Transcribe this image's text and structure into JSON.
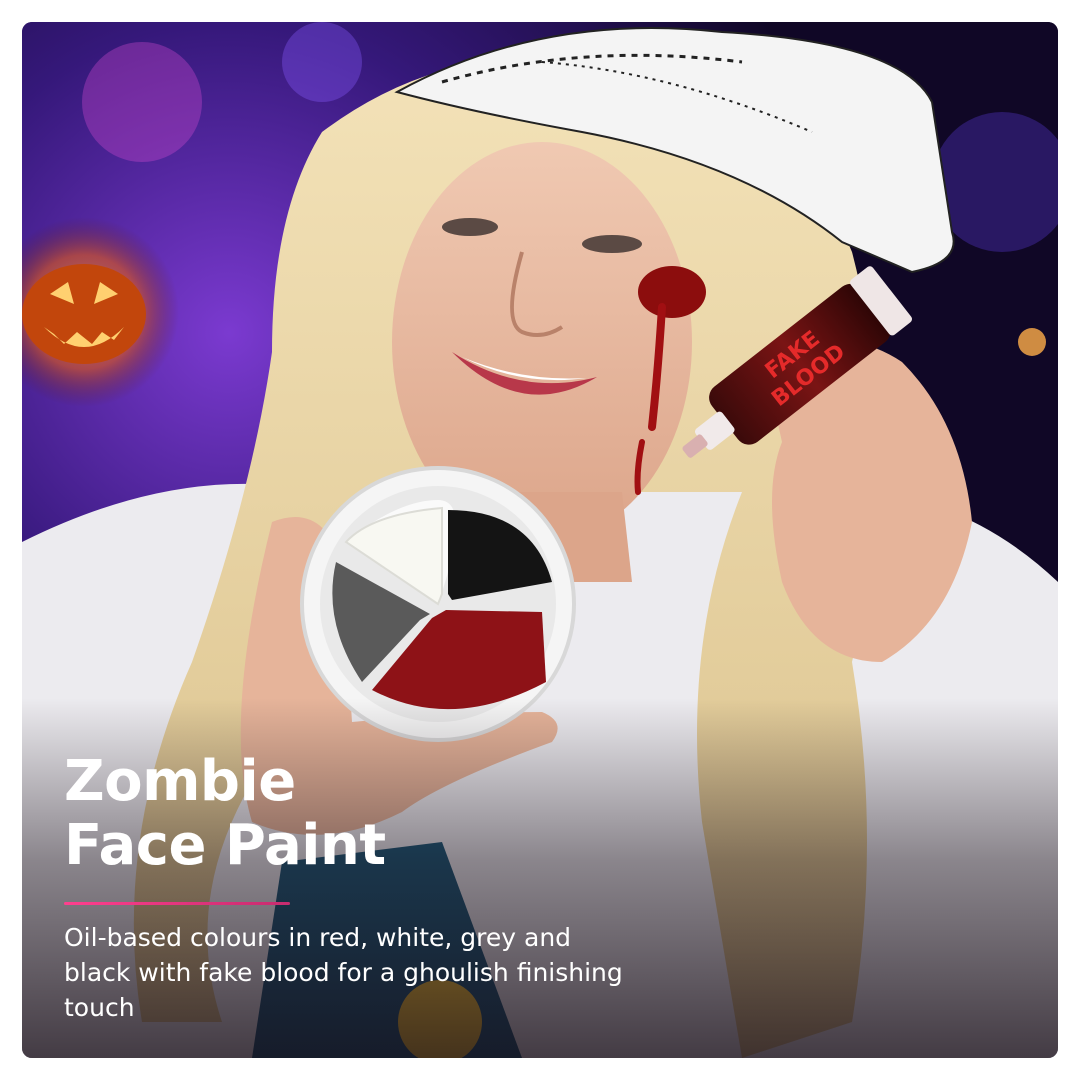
{
  "headline": {
    "line1": "Zombie",
    "line2": "Face Paint"
  },
  "description": "Oil-based colours in red, white, grey and black with fake blood for a ghoulish finishing touch",
  "photo": {
    "tube_label_line1": "FAKE",
    "tube_label_line2": "BLOOD",
    "palette_colors": [
      "white",
      "black",
      "grey",
      "red"
    ]
  },
  "colors": {
    "accent": "#e03a7e",
    "text": "#ffffff"
  }
}
